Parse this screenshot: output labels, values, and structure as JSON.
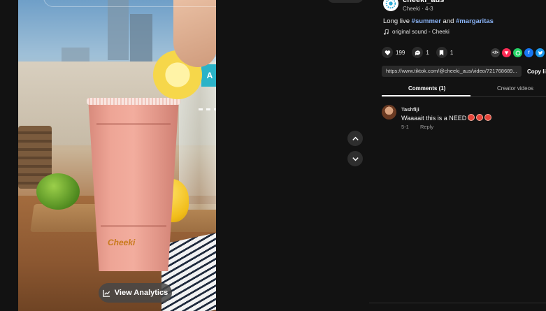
{
  "video": {
    "analytics_label": "View Analytics",
    "cup_logo": "Cheeki",
    "bottle_label": "A"
  },
  "post": {
    "username": "cheeki_aus",
    "display_name": "Cheeki",
    "date": "4-3",
    "caption_prefix": "Long live ",
    "tag1": "#summer",
    "caption_mid": " and ",
    "tag2": "#margaritas",
    "sound": "original sound - Cheeki"
  },
  "stats": {
    "likes": "199",
    "comments": "1",
    "saves": "1"
  },
  "share": {
    "link": "https://www.tiktok.com/@cheeki_aus/video/721768689...",
    "copy_label": "Copy li",
    "icons": [
      "embed-icon",
      "friends-icon",
      "whatsapp-icon",
      "facebook-icon",
      "twitter-icon"
    ],
    "colors": {
      "friends": "#fe2c55",
      "whatsapp": "#25d366",
      "facebook": "#1877f2",
      "twitter": "#1d9bf0"
    }
  },
  "tabs": {
    "comments": "Comments (1)",
    "creator": "Creator videos"
  },
  "comment": {
    "user": "Tashfiji",
    "text": "Waaaait this is a NEED",
    "date": "5-1",
    "reply": "Reply"
  },
  "colors": {
    "hashtag": "#8ab4f8",
    "background": "#121212"
  }
}
